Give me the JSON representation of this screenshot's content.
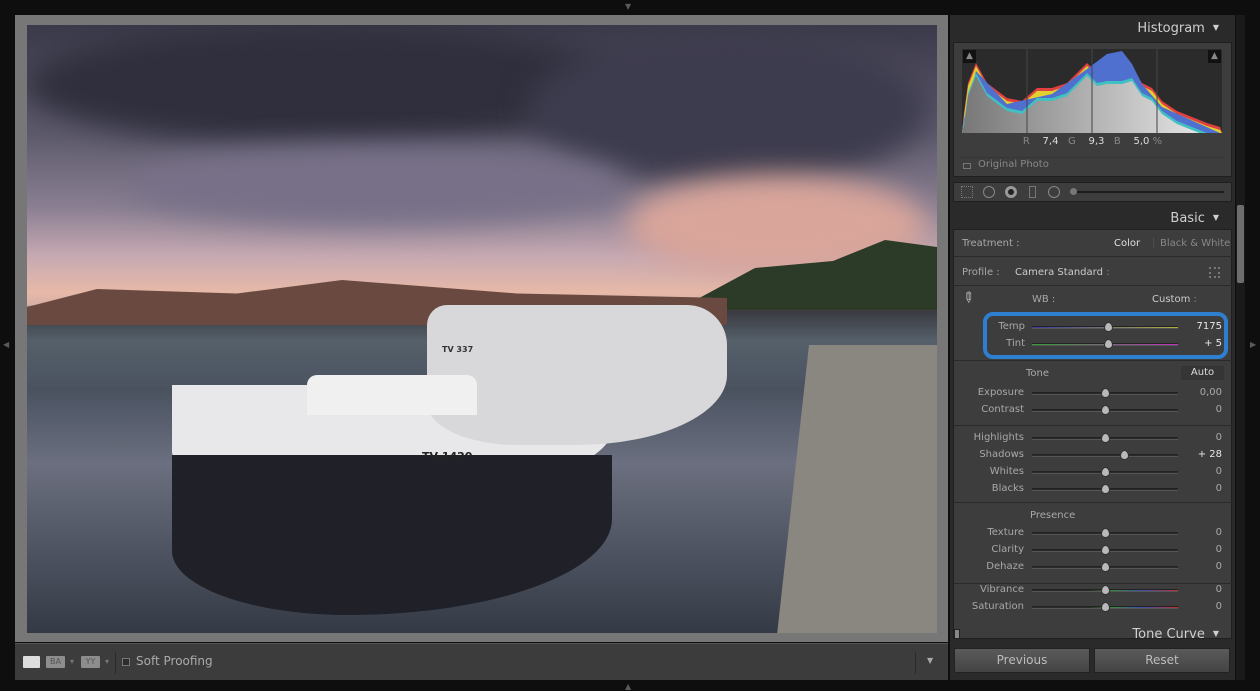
{
  "toolbar": {
    "soft_proofing_label": "Soft Proofing",
    "soft_proofing_checked": false,
    "view_icons": [
      "loupe-view-icon",
      "before-after-icon",
      "yy-compare-icon"
    ]
  },
  "histogram": {
    "title": "Histogram",
    "r_label": "R",
    "r_value": "7,4",
    "g_label": "G",
    "g_value": "9,3",
    "b_label": "B",
    "b_value": "5,0",
    "unit": "%",
    "original_photo_label": "Original Photo"
  },
  "tools": [
    "crop-grid-icon",
    "spot-removal-icon",
    "red-eye-icon",
    "graduated-filter-icon",
    "radial-filter-icon",
    "brush-size-slider"
  ],
  "basic": {
    "title": "Basic",
    "treatment_label": "Treatment :",
    "treatment_color": "Color",
    "treatment_bw": "Black & White",
    "profile_label": "Profile :",
    "profile_value": "Camera Standard",
    "wb_label": "WB :",
    "wb_value": "Custom",
    "highlight_color": "#2f7fd0",
    "wb_sliders": [
      {
        "label": "Temp",
        "value": "7175",
        "position": 0.52,
        "gradient": [
          "#3a3aa0",
          "#b0b040"
        ]
      },
      {
        "label": "Tint",
        "value": "+ 5",
        "position": 0.52,
        "gradient": [
          "#30a030",
          "#c030c0"
        ]
      }
    ],
    "tone_label": "Tone",
    "auto_label": "Auto",
    "tone_sliders": [
      {
        "label": "Exposure",
        "value": "0,00",
        "position": 0.5
      },
      {
        "label": "Contrast",
        "value": "0",
        "position": 0.5
      }
    ],
    "light_sliders": [
      {
        "label": "Highlights",
        "value": "0",
        "position": 0.5
      },
      {
        "label": "Shadows",
        "value": "+ 28",
        "position": 0.63
      },
      {
        "label": "Whites",
        "value": "0",
        "position": 0.5
      },
      {
        "label": "Blacks",
        "value": "0",
        "position": 0.5
      }
    ],
    "presence_label": "Presence",
    "presence_sliders": [
      {
        "label": "Texture",
        "value": "0",
        "position": 0.5
      },
      {
        "label": "Clarity",
        "value": "0",
        "position": 0.5
      },
      {
        "label": "Dehaze",
        "value": "0",
        "position": 0.5
      }
    ],
    "color_sliders": [
      {
        "label": "Vibrance",
        "value": "0",
        "position": 0.5
      },
      {
        "label": "Saturation",
        "value": "0",
        "position": 0.5
      }
    ]
  },
  "tone_curve": {
    "title": "Tone Curve"
  },
  "buttons": {
    "previous": "Previous",
    "reset": "Reset"
  },
  "photo": {
    "boat_text": "TV 1420",
    "boat2_text": "TV 337"
  }
}
